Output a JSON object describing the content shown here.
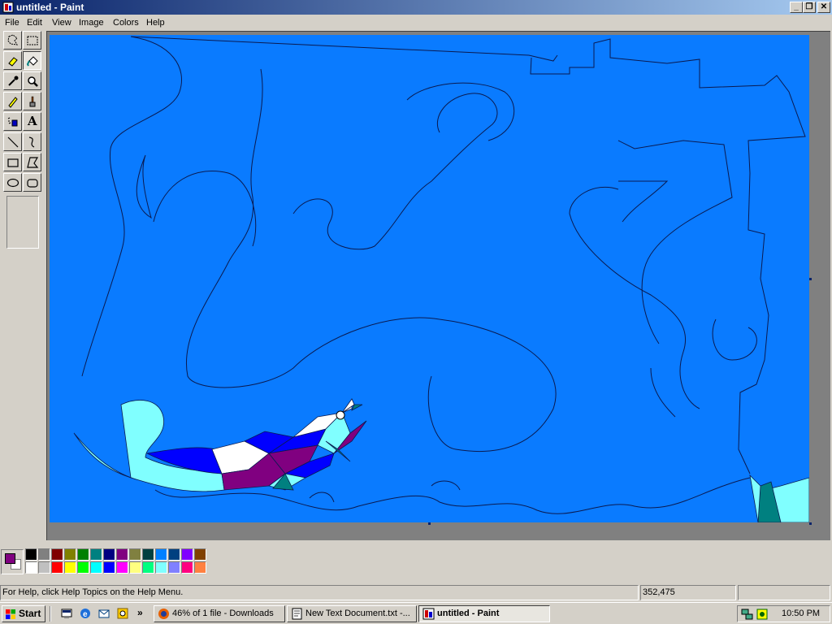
{
  "window": {
    "title": "untitled - Paint",
    "controls": [
      "_",
      "❐",
      "✕"
    ]
  },
  "menu": [
    "File",
    "Edit",
    "View",
    "Image",
    "Colors",
    "Help"
  ],
  "tools": [
    {
      "name": "free-form-select-tool"
    },
    {
      "name": "select-tool"
    },
    {
      "name": "eraser-tool"
    },
    {
      "name": "fill-with-color-tool"
    },
    {
      "name": "pick-color-tool"
    },
    {
      "name": "magnifier-tool"
    },
    {
      "name": "pencil-tool"
    },
    {
      "name": "brush-tool"
    },
    {
      "name": "airbrush-tool"
    },
    {
      "name": "text-tool"
    },
    {
      "name": "line-tool"
    },
    {
      "name": "curve-tool"
    },
    {
      "name": "rectangle-tool"
    },
    {
      "name": "polygon-tool"
    },
    {
      "name": "ellipse-tool"
    },
    {
      "name": "rounded-rectangle-tool"
    }
  ],
  "text_tool_glyph": "A",
  "active_tool": "fill-with-color-tool",
  "colors": {
    "foreground": "#800080",
    "background": "#ffffff",
    "canvas": "#0a7bff",
    "palette_top": [
      "#000000",
      "#808080",
      "#800000",
      "#808000",
      "#008000",
      "#008080",
      "#000080",
      "#800080",
      "#808040",
      "#004040",
      "#0080ff",
      "#004080",
      "#8000ff",
      "#804000"
    ],
    "palette_bottom": [
      "#ffffff",
      "#c0c0c0",
      "#ff0000",
      "#ffff00",
      "#00ff00",
      "#00ffff",
      "#0000ff",
      "#ff00ff",
      "#ffff80",
      "#00ff80",
      "#80ffff",
      "#8080ff",
      "#ff0080",
      "#ff8040"
    ]
  },
  "status": {
    "help": "For Help, click Help Topics on the Help Menu.",
    "coords": "352,475",
    "size": ""
  },
  "taskbar": {
    "start": "Start",
    "chevron": "»",
    "tasks": [
      {
        "label": "46% of 1 file - Downloads",
        "active": false
      },
      {
        "label": "New Text Document.txt -...",
        "active": false
      },
      {
        "label": "untitled - Paint",
        "active": true
      }
    ],
    "clock": "10:50 PM"
  }
}
